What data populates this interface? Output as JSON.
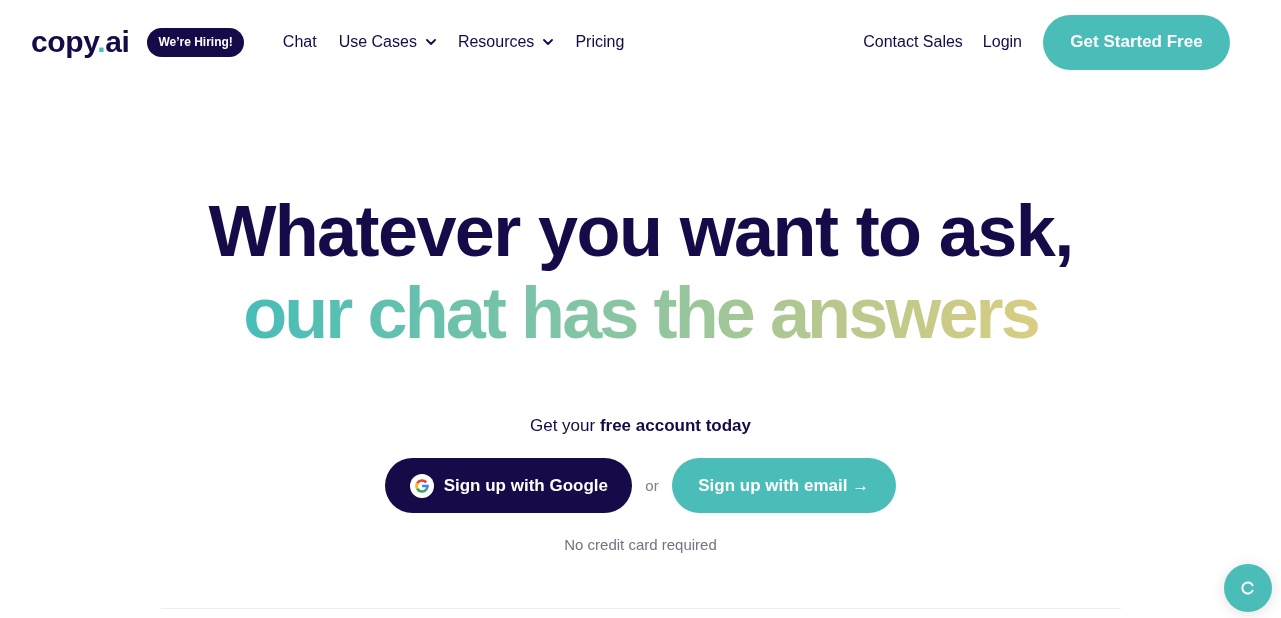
{
  "logo": {
    "word": "copy",
    "dot": ".",
    "suffix": "ai"
  },
  "hiring_badge": "We’re Hiring!",
  "nav_links": [
    {
      "label": "Chat",
      "kind": "link"
    },
    {
      "label": "Use Cases",
      "kind": "dropdown"
    },
    {
      "label": "Resources",
      "kind": "dropdown"
    },
    {
      "label": "Pricing",
      "kind": "link"
    }
  ],
  "nav_right": {
    "links": [
      "Contact Sales",
      "Login"
    ],
    "cta": "Get Started Free"
  },
  "hero": {
    "heading_lines": [
      {
        "text": "Whatever you want to ask,",
        "kind": "solid"
      },
      {
        "text": "our chat has the answers",
        "kind": "gradient"
      }
    ],
    "subheading": "Get your **free account today**",
    "google_button": "Sign up with Google",
    "separator": "or",
    "email_button": "Sign up with email →",
    "note": "No credit card required"
  }
}
